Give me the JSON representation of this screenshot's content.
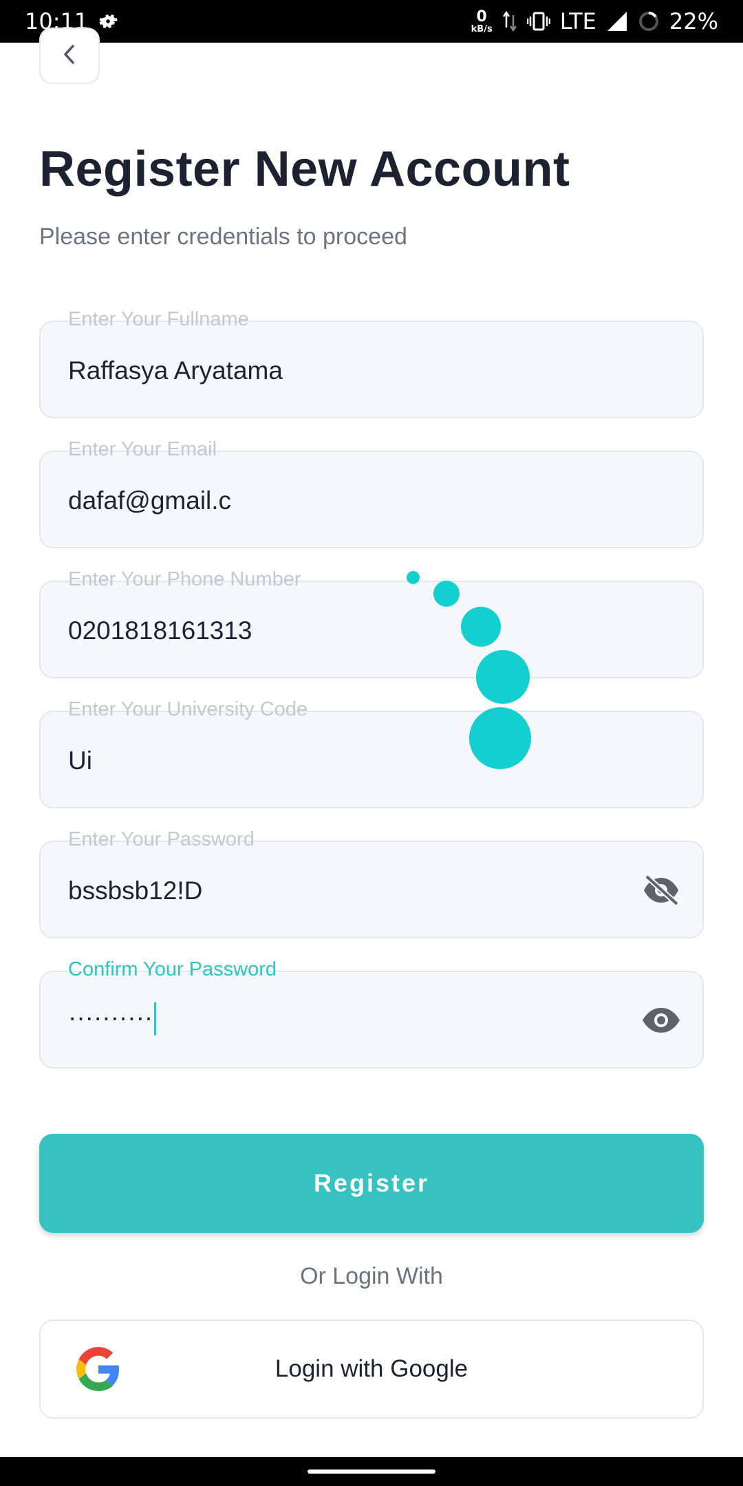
{
  "status_bar": {
    "time": "10:11",
    "net_speed_value": "0",
    "net_speed_unit": "kB/s",
    "network": "LTE",
    "battery": "22%"
  },
  "header": {
    "title": "Register New Account",
    "subtitle": "Please enter credentials to proceed"
  },
  "form": {
    "fullname": {
      "label": "Enter Your Fullname",
      "value": "Raffasya Aryatama"
    },
    "email": {
      "label": "Enter Your Email",
      "value": "dafaf@gmail.c"
    },
    "phone": {
      "label": "Enter Your Phone Number",
      "value": "0201818161313"
    },
    "university": {
      "label": "Enter Your University Code",
      "value": "Ui"
    },
    "password": {
      "label": "Enter Your Password",
      "value": "bssbsb12!D"
    },
    "confirm_password": {
      "label": "Confirm Your Password",
      "value": "··········"
    }
  },
  "actions": {
    "register_label": "Register",
    "or_text": "Or Login With",
    "google_label": "Login with Google"
  },
  "icons": {
    "back": "chevron-left-icon",
    "password_toggle": "eye-off-icon",
    "confirm_toggle": "eye-icon",
    "google": "google-logo-icon"
  },
  "colors": {
    "accent": "#36c2be",
    "loading_dots": "#13cfcf",
    "focused_label": "#2ec4c0"
  }
}
